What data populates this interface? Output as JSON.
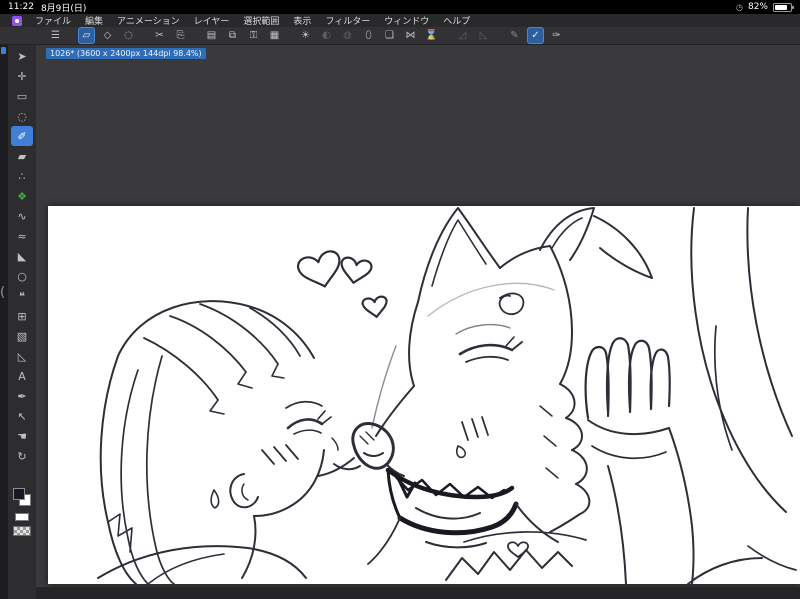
{
  "colors": {
    "accent_blue": "#3f7fd6",
    "active_toolbar_blue": "#2d5f9e",
    "decoration_green": "#3fae49",
    "canvas_ink": "#2e2e38",
    "paper": "#ffffff",
    "workspace_gray": "#3a3a3c"
  },
  "status_bar": {
    "time": "11:22",
    "date": "8月9日(日)",
    "indicator_glyph": "◷",
    "battery_percent": "82%"
  },
  "menu_bar": {
    "items": [
      "ファイル",
      "編集",
      "アニメーション",
      "レイヤー",
      "選択範囲",
      "表示",
      "フィルター",
      "ウィンドウ",
      "ヘルプ"
    ]
  },
  "toolbar": {
    "items": [
      {
        "name": "main-menu",
        "glyph": "☰",
        "state": "normal"
      },
      {
        "name": "transform",
        "glyph": "▱",
        "state": "active"
      },
      {
        "name": "snap-diamond",
        "glyph": "◇",
        "state": "normal"
      },
      {
        "name": "snap-circle",
        "glyph": "◌",
        "state": "normal"
      },
      {
        "name": "cut",
        "glyph": "✂",
        "state": "normal"
      },
      {
        "name": "paste",
        "glyph": "⎘",
        "state": "normal"
      },
      {
        "name": "canvas-new",
        "glyph": "▤",
        "state": "normal"
      },
      {
        "name": "pages",
        "glyph": "⧉",
        "state": "normal"
      },
      {
        "name": "lock",
        "glyph": "⚿",
        "state": "normal"
      },
      {
        "name": "grid",
        "glyph": "▦",
        "state": "normal"
      },
      {
        "name": "brightness",
        "glyph": "☀",
        "state": "normal"
      },
      {
        "name": "contrast",
        "glyph": "◐",
        "state": "disabled"
      },
      {
        "name": "tone",
        "glyph": "◍",
        "state": "disabled"
      },
      {
        "name": "droplet",
        "glyph": "⬯",
        "state": "normal"
      },
      {
        "name": "crop",
        "glyph": "❏",
        "state": "normal"
      },
      {
        "name": "flip-horizontal",
        "glyph": "⋈",
        "state": "normal"
      },
      {
        "name": "hourglass",
        "glyph": "⌛",
        "state": "normal"
      },
      {
        "name": "angle-snap-1",
        "glyph": "◿",
        "state": "disabled"
      },
      {
        "name": "angle-snap-2",
        "glyph": "◺",
        "state": "disabled"
      },
      {
        "name": "stabilizer",
        "glyph": "✎",
        "state": "dim"
      },
      {
        "name": "stabilizer-on",
        "glyph": "✓",
        "state": "active"
      },
      {
        "name": "pen-pressure",
        "glyph": "✑",
        "state": "normal"
      }
    ]
  },
  "rail": {
    "collapse_glyph": "("
  },
  "tool_palette": {
    "foreground_color": "#191926",
    "background_color": "#ffffff",
    "tools": [
      {
        "name": "operation-tool",
        "glyph": "➤",
        "state": "normal"
      },
      {
        "name": "move-tool",
        "glyph": "✛",
        "state": "normal"
      },
      {
        "name": "marquee-tool",
        "glyph": "▭",
        "state": "normal"
      },
      {
        "name": "lasso-tool",
        "glyph": "◌",
        "state": "normal"
      },
      {
        "name": "marker-tool",
        "glyph": "✐",
        "state": "selected"
      },
      {
        "name": "eraser-tool",
        "glyph": "▰",
        "state": "normal"
      },
      {
        "name": "airbrush-tool",
        "glyph": "∴",
        "state": "normal"
      },
      {
        "name": "decoration-tool",
        "glyph": "❖",
        "state": "green"
      },
      {
        "name": "blend-tool",
        "glyph": "∿",
        "state": "normal"
      },
      {
        "name": "mix-tool",
        "glyph": "≈",
        "state": "normal"
      },
      {
        "name": "fill-tool",
        "glyph": "◣",
        "state": "normal"
      },
      {
        "name": "figure-tool",
        "glyph": "○",
        "state": "normal"
      },
      {
        "name": "balloon-tool",
        "glyph": "❝",
        "state": "normal"
      },
      {
        "name": "frame-tool",
        "glyph": "⊞",
        "state": "normal"
      },
      {
        "name": "gradient-tool",
        "glyph": "▧",
        "state": "normal"
      },
      {
        "name": "ruler-tool",
        "glyph": "◺",
        "state": "normal"
      },
      {
        "name": "text-tool",
        "glyph": "A",
        "state": "normal"
      },
      {
        "name": "nib-tool",
        "glyph": "✒",
        "state": "normal"
      },
      {
        "name": "arrow-tool",
        "glyph": "↖",
        "state": "normal"
      },
      {
        "name": "hand-tool",
        "glyph": "☚",
        "state": "normal"
      },
      {
        "name": "rotate-tool",
        "glyph": "↻",
        "state": "normal"
      }
    ]
  },
  "workspace": {
    "document_tab": "1026* (3600 x 2400px 144dpi 98.4%)"
  }
}
